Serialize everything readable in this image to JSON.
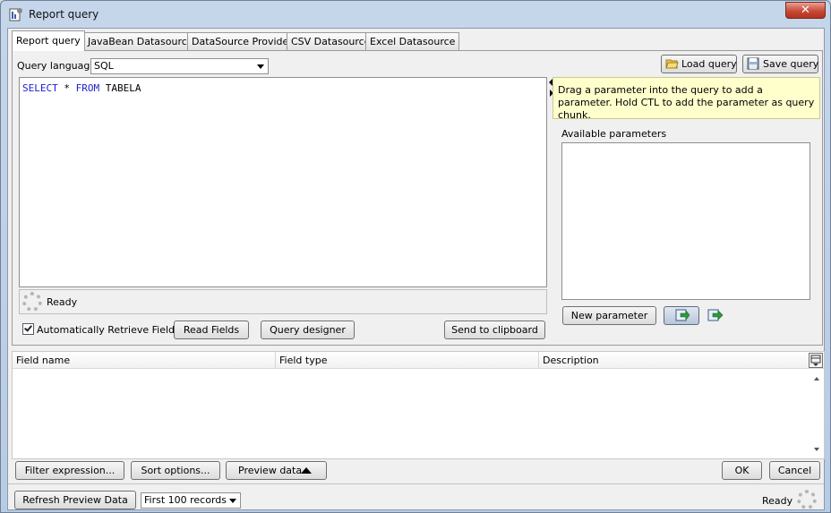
{
  "window": {
    "title": "Report query",
    "close_glyph": "✕"
  },
  "tabs": [
    {
      "label": "Report query",
      "active": true
    },
    {
      "label": "JavaBean Datasource"
    },
    {
      "label": "DataSource Provider"
    },
    {
      "label": "CSV Datasource"
    },
    {
      "label": "Excel Datasource"
    }
  ],
  "query": {
    "language_label": "Query language",
    "language_value": "SQL",
    "load_button": "Load query",
    "save_button": "Save query",
    "sql_kw1": "SELECT",
    "sql_mid": " * ",
    "sql_kw2": "FROM",
    "sql_rest": " TABELA",
    "status": "Ready",
    "auto_retrieve_label": "Automatically Retrieve Fields",
    "auto_retrieve_checked": true,
    "read_fields_button": "Read Fields",
    "query_designer_button": "Query designer",
    "send_clipboard_button": "Send to clipboard"
  },
  "parameters": {
    "hint": "Drag a parameter into the query to add a parameter. Hold CTL to add the parameter as query chunk.",
    "available_label": "Available parameters",
    "new_parameter_button": "New parameter"
  },
  "fields_table": {
    "columns": [
      "Field name",
      "Field type",
      "Description"
    ]
  },
  "footer": {
    "filter_button": "Filter expression...",
    "sort_button": "Sort options...",
    "preview_button": "Preview data",
    "ok_button": "OK",
    "cancel_button": "Cancel",
    "refresh_button": "Refresh Preview Data",
    "records_value": "First 100 records",
    "status": "Ready"
  },
  "colors": {
    "sql_keyword": "#1c1ccc",
    "hint_background": "#ffffcc",
    "close_button": "#c74a35"
  }
}
